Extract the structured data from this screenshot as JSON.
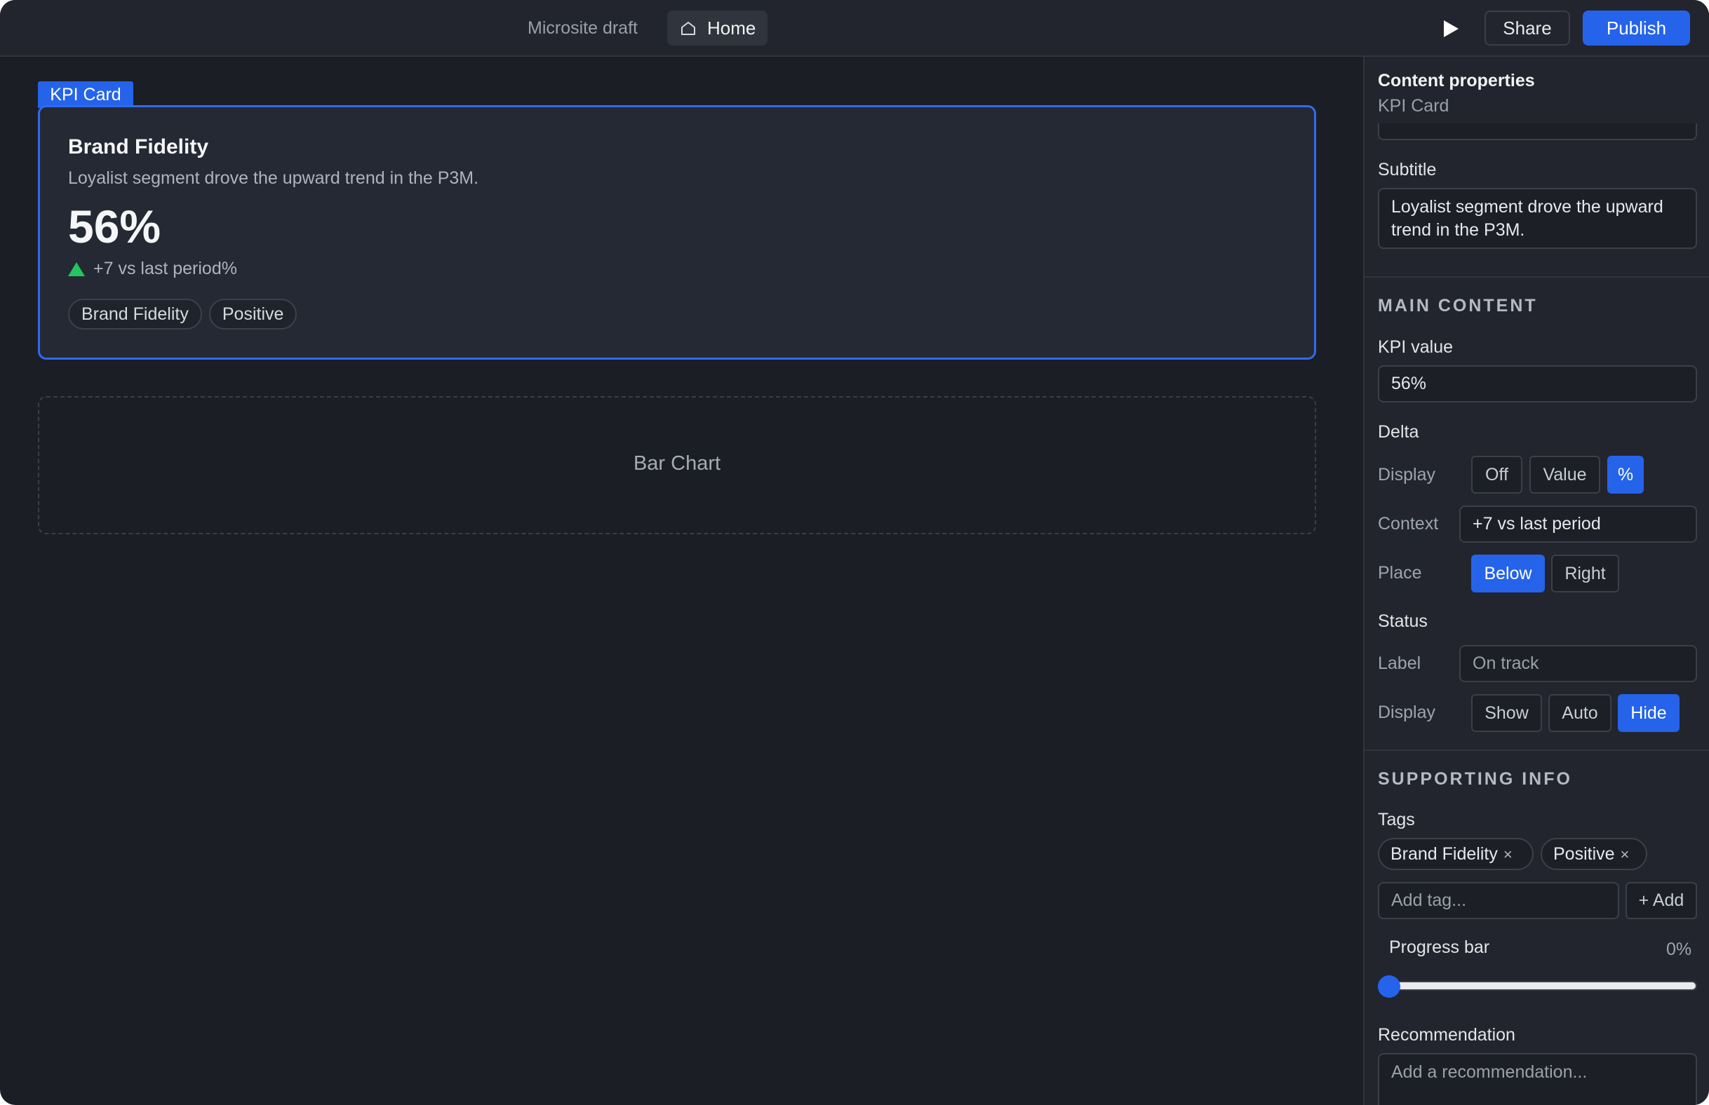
{
  "topbar": {
    "draft_label": "Microsite draft",
    "page_name": "Home",
    "share_label": "Share",
    "publish_label": "Publish"
  },
  "canvas": {
    "selected_tag": "KPI Card",
    "kpi_card": {
      "title": "Brand Fidelity",
      "subtitle": "Loyalist segment drove the upward trend in the P3M.",
      "value": "56%",
      "delta_text": "+7 vs last period%",
      "tags": [
        "Brand Fidelity",
        "Positive"
      ]
    },
    "placeholder_label": "Bar Chart"
  },
  "panel": {
    "title": "Content properties",
    "subtitle": "KPI Card",
    "subtitle_label": "Subtitle",
    "subtitle_value": "Loyalist segment drove the upward trend in the P3M.",
    "main_section": "MAIN CONTENT",
    "kpi_value_label": "KPI value",
    "kpi_value": "56%",
    "delta": {
      "heading": "Delta",
      "display_label": "Display",
      "display_options": [
        "Off",
        "Value",
        "%"
      ],
      "display_selected": "%",
      "context_label": "Context",
      "context_value": "+7 vs last period",
      "place_label": "Place",
      "place_options": [
        "Below",
        "Right"
      ],
      "place_selected": "Below"
    },
    "status": {
      "heading": "Status",
      "label_label": "Label",
      "label_placeholder": "On track",
      "display_label": "Display",
      "display_options": [
        "Show",
        "Auto",
        "Hide"
      ],
      "display_selected": "Hide"
    },
    "supporting_section": "SUPPORTING INFO",
    "tags_label": "Tags",
    "tags": [
      "Brand Fidelity",
      "Positive"
    ],
    "tag_remove_glyph": "×",
    "add_tag_placeholder": "Add tag...",
    "add_button": "+ Add",
    "progress_label": "Progress bar",
    "progress_value_text": "0%",
    "progress_value": 0,
    "recommendation_label": "Recommendation",
    "recommendation_placeholder": "Add a recommendation..."
  },
  "colors": {
    "accent": "#2563eb",
    "positive": "#22c55e",
    "background": "#1b1e25",
    "panel": "#22252d"
  },
  "icons": {
    "home": "home-icon",
    "play": "play-icon",
    "delta_up": "triangle-up-icon",
    "remove_tag": "close-icon"
  }
}
